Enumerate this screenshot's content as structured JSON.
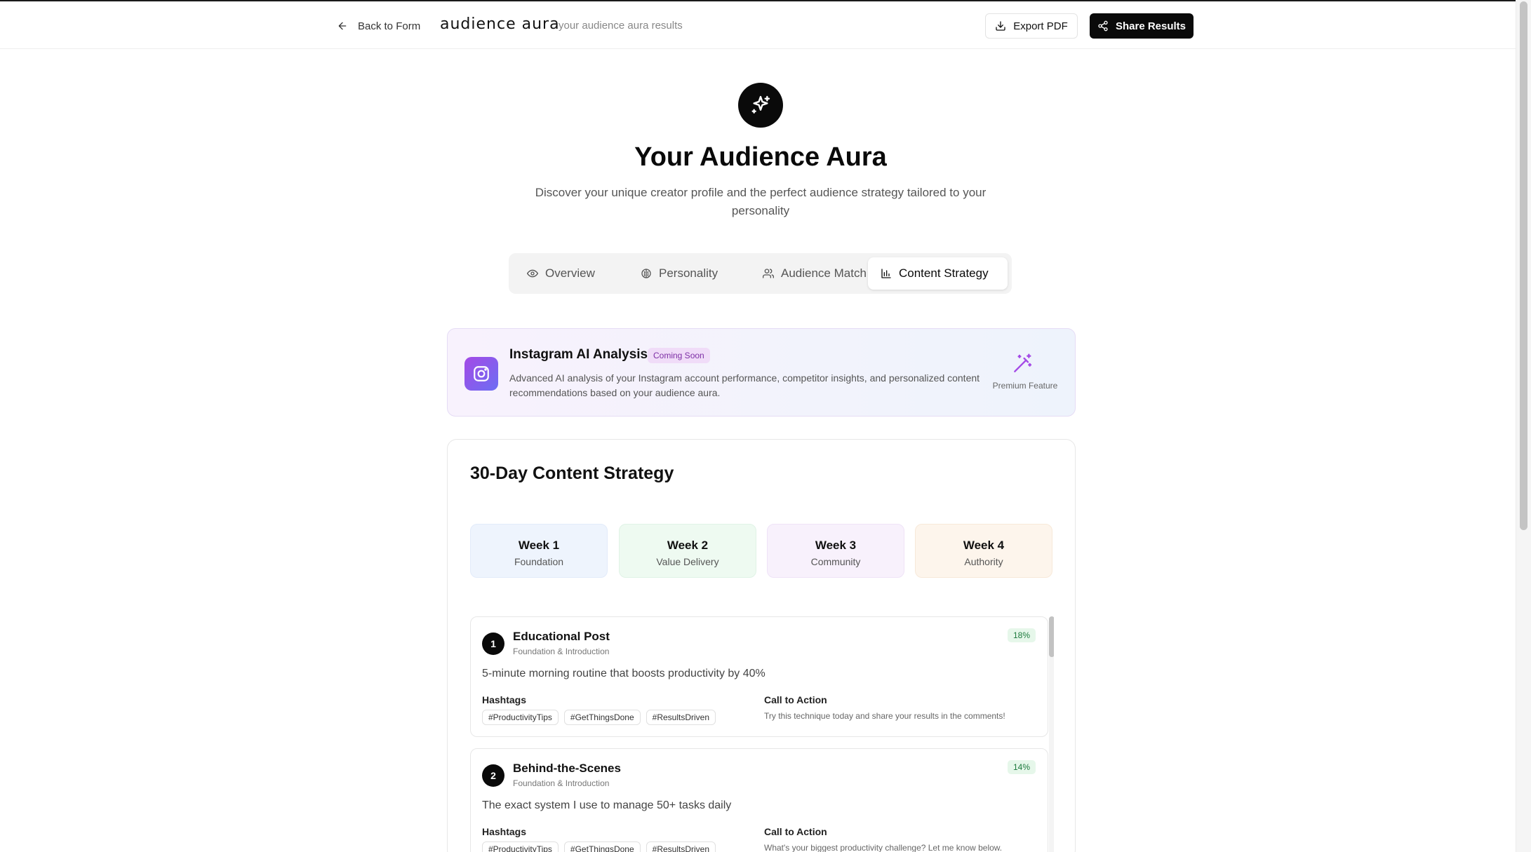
{
  "header": {
    "back_label": "Back to Form",
    "logo": "audience aura",
    "subtitle": "your audience aura results",
    "export_label": "Export PDF",
    "share_label": "Share Results"
  },
  "hero": {
    "title": "Your Audience Aura",
    "description": "Discover your unique creator profile and the perfect audience strategy tailored to your personality"
  },
  "tabs": [
    {
      "label": "Overview",
      "icon": "eye-icon"
    },
    {
      "label": "Personality",
      "icon": "brain-icon"
    },
    {
      "label": "Audience Match",
      "icon": "users-icon"
    },
    {
      "label": "Content Strategy",
      "icon": "bar-chart-icon",
      "active": true
    }
  ],
  "instagram": {
    "title": "Instagram AI Analysis",
    "badge": "Coming Soon",
    "description": "Advanced AI analysis of your Instagram account performance, competitor insights, and personalized content recommendations based on your audience aura.",
    "premium_label": "Premium Feature"
  },
  "strategy": {
    "title": "30-Day Content Strategy",
    "weeks": [
      {
        "name": "Week 1",
        "theme": "Foundation"
      },
      {
        "name": "Week 2",
        "theme": "Value Delivery"
      },
      {
        "name": "Week 3",
        "theme": "Community"
      },
      {
        "name": "Week 4",
        "theme": "Authority"
      }
    ],
    "hashtags_label": "Hashtags",
    "cta_label": "Call to Action",
    "posts": [
      {
        "number": "1",
        "title": "Educational Post",
        "phase": "Foundation & Introduction",
        "percent": "18%",
        "text": "5-minute morning routine that boosts productivity by 40%",
        "hashtags": [
          "#ProductivityTips",
          "#GetThingsDone",
          "#ResultsDriven"
        ],
        "cta": "Try this technique today and share your results in the comments!"
      },
      {
        "number": "2",
        "title": "Behind-the-Scenes",
        "phase": "Foundation & Introduction",
        "percent": "14%",
        "text": "The exact system I use to manage 50+ tasks daily",
        "hashtags": [
          "#ProductivityTips",
          "#GetThingsDone",
          "#ResultsDriven"
        ],
        "cta": "What's your biggest productivity challenge? Let me know below."
      }
    ]
  },
  "colors": {
    "primary": "#0a0a0a",
    "accent_purple": "#a44ae6",
    "badge_green": "#1d7a3d"
  }
}
